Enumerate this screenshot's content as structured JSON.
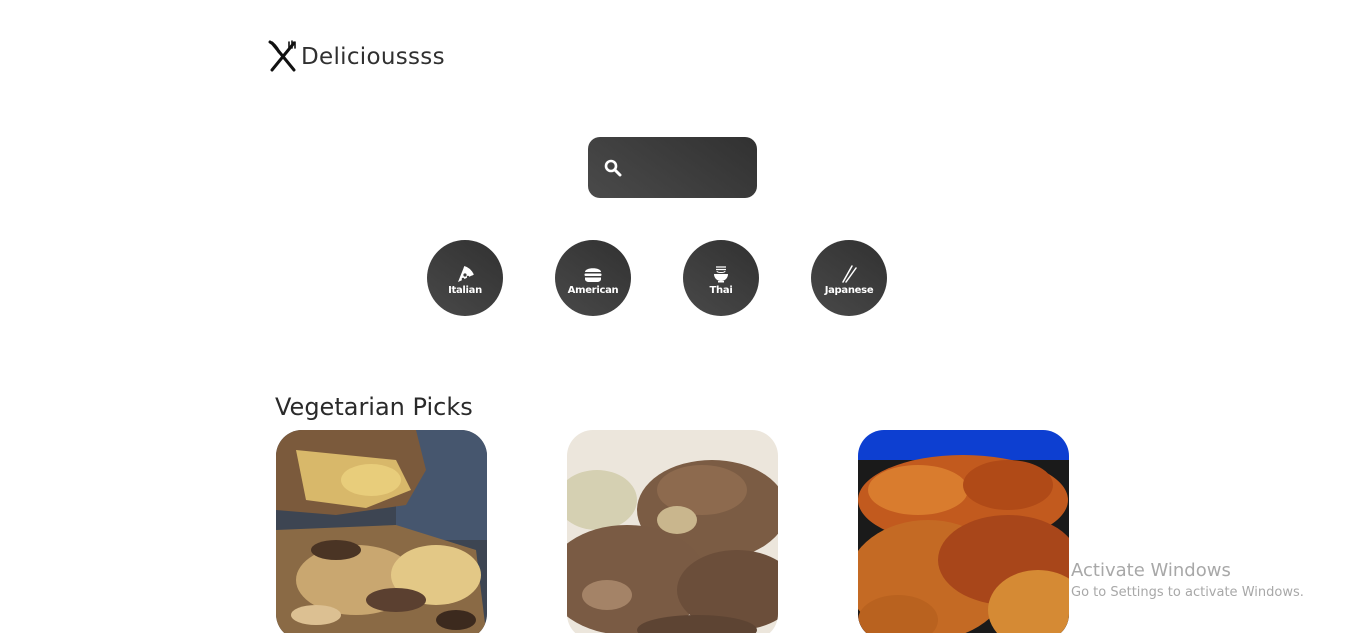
{
  "header": {
    "logo_text": "Delicioussss",
    "logo_icon": "fork-knife-icon"
  },
  "search": {
    "icon": "search-icon",
    "value": "",
    "placeholder": ""
  },
  "categories": [
    {
      "label": "Italian",
      "icon": "pizza-icon"
    },
    {
      "label": "American",
      "icon": "burger-icon"
    },
    {
      "label": "Thai",
      "icon": "noodle-bowl-icon"
    },
    {
      "label": "Japanese",
      "icon": "chopsticks-icon"
    }
  ],
  "section": {
    "title": "Vegetarian Picks"
  },
  "cards": [
    {
      "image": "food-photo-cheesy-flatbread"
    },
    {
      "image": "food-photo-veggie-patties"
    },
    {
      "image": "food-photo-fried-fritters"
    }
  ],
  "watermark": {
    "title": "Activate Windows",
    "subtitle": "Go to Settings to activate Windows."
  },
  "colors": {
    "button_dark": "#3b3b3b",
    "text_dark": "#2a2a2a",
    "background": "#ffffff",
    "watermark": "#a8a8a8"
  }
}
